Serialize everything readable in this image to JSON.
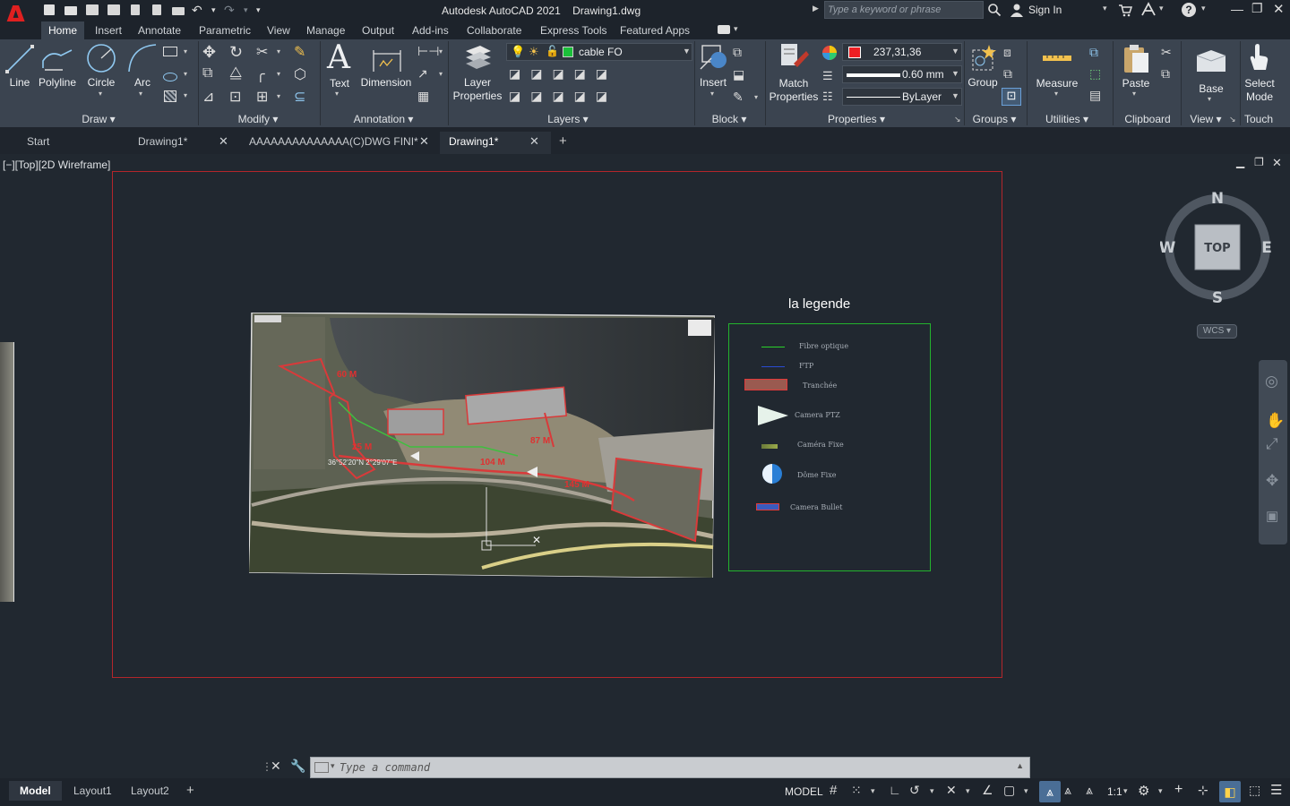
{
  "app": {
    "title": "Autodesk AutoCAD 2021",
    "document": "Drawing1.dwg",
    "logo": "A",
    "search_placeholder": "Type a keyword or phrase",
    "sign_in": "Sign In"
  },
  "ribbon_tabs": [
    "Home",
    "Insert",
    "Annotate",
    "Parametric",
    "View",
    "Manage",
    "Output",
    "Add-ins",
    "Collaborate",
    "Express Tools",
    "Featured Apps"
  ],
  "ribbon": {
    "draw": {
      "line": "Line",
      "polyline": "Polyline",
      "circle": "Circle",
      "arc": "Arc",
      "title": "Draw"
    },
    "modify": {
      "title": "Modify"
    },
    "annotation": {
      "text": "Text",
      "dimension": "Dimension",
      "title": "Annotation"
    },
    "layers": {
      "layer_props_1": "Layer",
      "layer_props_2": "Properties",
      "current_layer": "cable FO",
      "title": "Layers",
      "layer_color": "#1bbf3a"
    },
    "block": {
      "insert": "Insert",
      "title": "Block"
    },
    "properties": {
      "match_1": "Match",
      "match_2": "Properties",
      "color_value": "237,31,36",
      "color_swatch": "#ed1f24",
      "lineweight": "0.60 mm",
      "linetype": "ByLayer",
      "title": "Properties"
    },
    "groups": {
      "group": "Group",
      "title": "Groups"
    },
    "utilities": {
      "measure": "Measure",
      "title": "Utilities"
    },
    "clipboard": {
      "paste": "Paste",
      "title": "Clipboard"
    },
    "view": {
      "base": "Base",
      "title": "View"
    },
    "touch": {
      "select_1": "Select",
      "select_2": "Mode",
      "title": "Touch"
    }
  },
  "file_tabs": [
    {
      "label": "Start"
    },
    {
      "label": "Drawing1*"
    },
    {
      "label": "AAAAAAAAAAAAAA(C)DWG FINI*"
    },
    {
      "label": "Drawing1*"
    }
  ],
  "viewport": {
    "label": "[−][Top][2D Wireframe]",
    "legend_title": "la legende",
    "legend_items": [
      "Fibre optique",
      "FTP",
      "Tranchée",
      "Camera PTZ",
      "Caméra Fixe",
      "Dôme Fixe",
      "Camera Bullet"
    ],
    "map_labels": [
      "60 M",
      "25 M",
      "87 M",
      "104 M",
      "145 M"
    ],
    "coordinate": "36°52'20\"N 2°29'07\"E",
    "viewcube": {
      "face": "TOP",
      "n": "N",
      "s": "S",
      "e": "E",
      "w": "W",
      "wcs": "WCS"
    }
  },
  "command": {
    "placeholder": "Type a command"
  },
  "layout_tabs": [
    "Model",
    "Layout1",
    "Layout2"
  ],
  "status": {
    "model": "MODEL",
    "scale": "1:1"
  }
}
